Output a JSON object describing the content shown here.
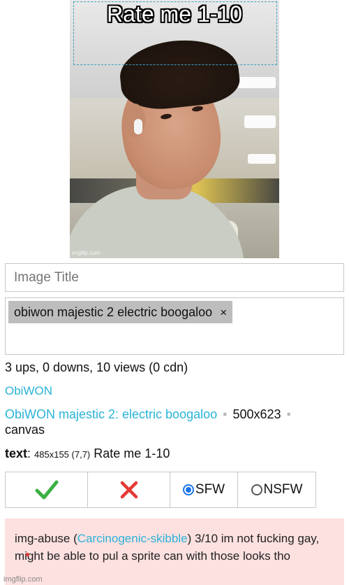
{
  "meme": {
    "caption": "Rate me 1-10",
    "watermark": "imgflip.com"
  },
  "form": {
    "title_placeholder": "Image Title",
    "tag": "obiwon majestic 2 electric boogaloo",
    "tag_remove": "×"
  },
  "stats": "3 ups, 0 downs, 10 views (0 cdn)",
  "uploader": "ObiWON",
  "meta": {
    "template": "ObiWON majestic 2: electric boogaloo",
    "dimensions": "500x623",
    "type": "canvas",
    "separator": "•"
  },
  "text_info": {
    "label": "text",
    "geometry": "485x155 (7,7)",
    "value": "Rate me 1-10"
  },
  "moderation": {
    "approve_icon": "checkmark-icon",
    "reject_icon": "x-icon",
    "sfw_label": "SFW",
    "nsfw_label": "NSFW",
    "selected": "SFW",
    "approve_color": "#3cb043",
    "reject_color": "#e53935"
  },
  "comment": {
    "prefix": "img-abuse (",
    "user": "Carcinogenic-skibble",
    "body": ") 3/10 im not fucking gay, might be able to pul a sprite can with those looks tho"
  },
  "footer": "imgflip.com"
}
